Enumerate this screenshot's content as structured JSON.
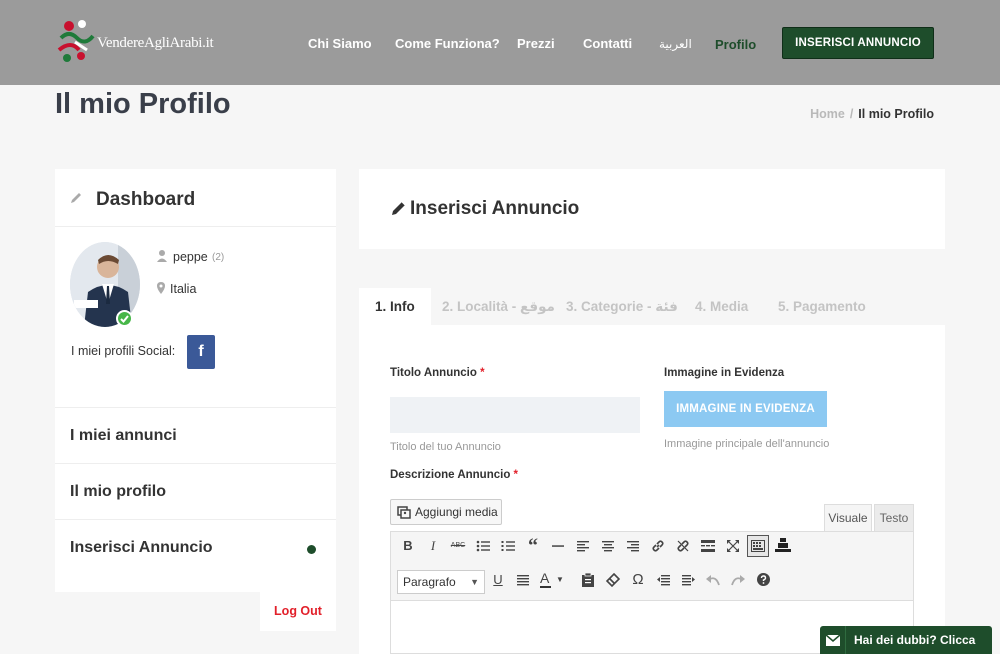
{
  "header": {
    "logo_text": "VendereAgliArabi.it",
    "nav": [
      "Chi Siamo",
      "Come Funziona?",
      "Prezzi",
      "Contatti",
      "العربية",
      "Profilo"
    ],
    "cta": "INSERISCI ANNUNCIO"
  },
  "page": {
    "title": "Il mio Profilo",
    "breadcrumb": {
      "home": "Home",
      "sep": "/",
      "current": "Il mio Profilo"
    }
  },
  "sidebar": {
    "title": "Dashboard",
    "username": "peppe",
    "user_count": "(2)",
    "location": "Italia",
    "social_label": "I miei profili Social:",
    "facebook_glyph": "f",
    "items": [
      "I miei annunci",
      "Il mio profilo",
      "Inserisci Annuncio"
    ],
    "logout": "Log Out"
  },
  "main": {
    "title": "Inserisci Annuncio",
    "tabs": [
      "1. Info",
      "2. Località - موقع",
      "3. Categorie - فئة",
      "4. Media",
      "5. Pagamento"
    ],
    "form": {
      "title_label": "Titolo Annuncio",
      "title_value": "",
      "title_help": "Titolo del tuo Annuncio",
      "image_label": "Immagine in Evidenza",
      "image_button": "IMMAGINE IN EVIDENZA",
      "image_help": "Immagine principale dell'annuncio",
      "desc_label": "Descrizione Annuncio",
      "required_mark": "*",
      "add_media": "Aggiungi media",
      "editor_tab_visual": "Visuale",
      "editor_tab_text": "Testo",
      "format_select": "Paragrafo"
    }
  },
  "help_bar": {
    "label": "Hai dei dubbi? Clicca Qui"
  },
  "colors": {
    "brand_green": "#1e4d2b",
    "header_gray": "#9b9b9b",
    "accent_blue": "#8cc9f2",
    "danger_red": "#e2202a"
  }
}
